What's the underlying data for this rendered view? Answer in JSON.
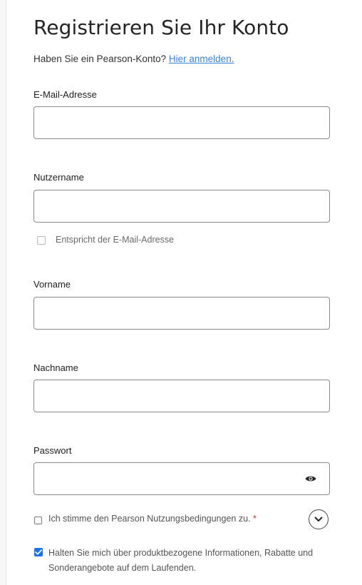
{
  "form": {
    "title": "Registrieren Sie Ihr Konto",
    "login_prompt": "Haben Sie ein Pearson-Konto?",
    "login_link": "Hier anmelden.",
    "email_label": "E-Mail-Adresse",
    "email_value": "",
    "username_label": "Nutzername",
    "username_value": "",
    "same_as_email_label": "Entspricht der E-Mail-Adresse",
    "same_as_email_checked": false,
    "firstname_label": "Vorname",
    "firstname_value": "",
    "lastname_label": "Nachname",
    "lastname_value": "",
    "password_label": "Passwort",
    "password_value": "",
    "password_toggle_icon": "eye-icon",
    "tos_label": "Ich stimme den Pearson Nutzungsbedingungen zu.",
    "tos_required_mark": "*",
    "tos_checked": false,
    "expand_icon": "chevron-down-icon",
    "promo_label": "Halten Sie mich über produktbezogene Informationen, Rabatte und Sonderangebote auf dem Laufenden.",
    "promo_checked": true
  },
  "colors": {
    "link": "#3b82d6",
    "checkbox_checked": "#1a73e8",
    "required": "#c0392b"
  }
}
